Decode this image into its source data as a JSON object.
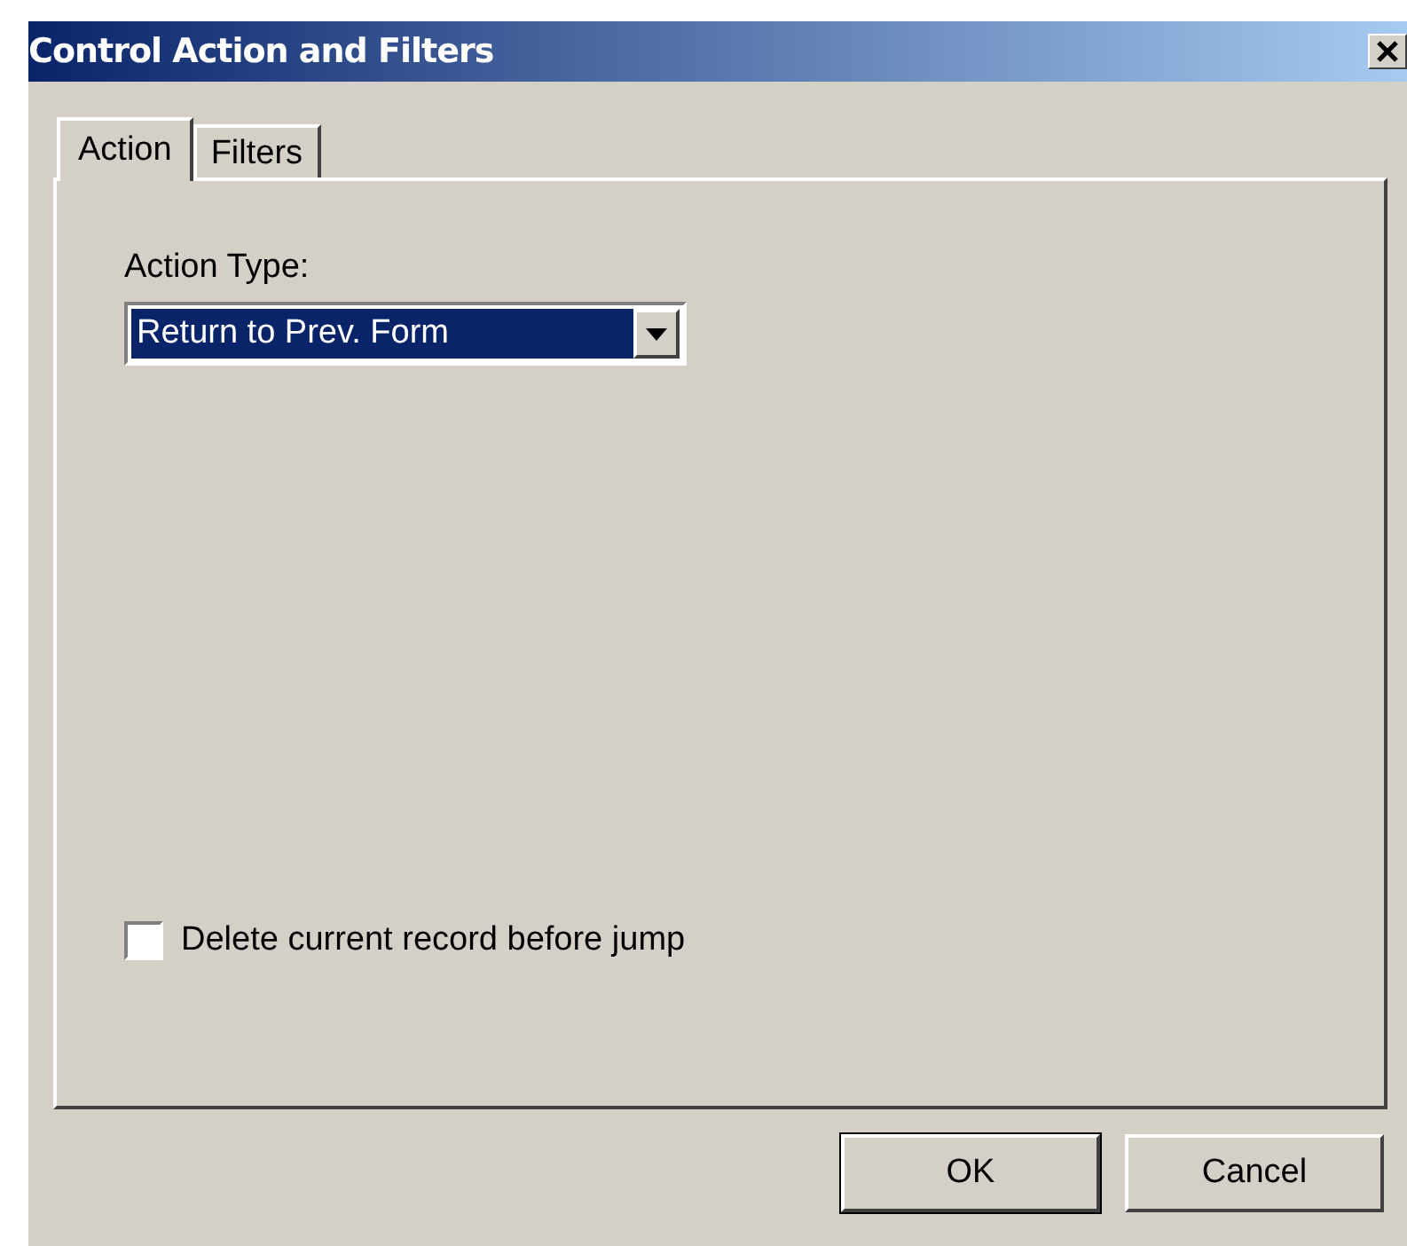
{
  "window": {
    "title": "Control Action and Filters"
  },
  "tabs": [
    {
      "label": "Action",
      "selected": true
    },
    {
      "label": "Filters",
      "selected": false
    }
  ],
  "action_type": {
    "label": "Action Type:",
    "value": "Return to Prev. Form",
    "focused": true
  },
  "options": [
    {
      "label": "Delete current record before jump",
      "checked": false
    }
  ],
  "buttons": [
    {
      "label": "OK",
      "default": true
    },
    {
      "label": "Cancel",
      "default": false
    }
  ]
}
